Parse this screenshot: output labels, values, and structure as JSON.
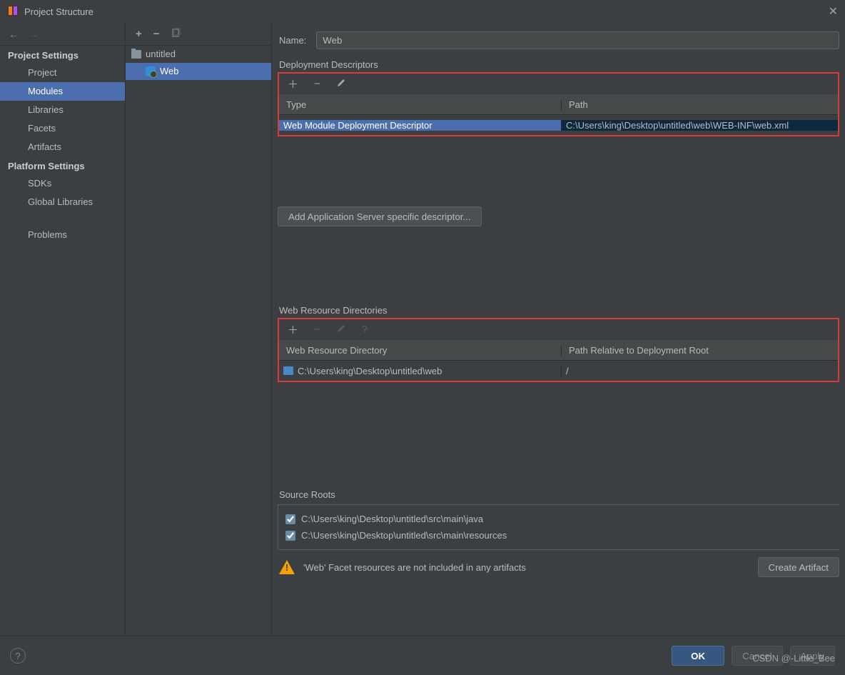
{
  "window": {
    "title": "Project Structure"
  },
  "sidebar": {
    "sections": [
      {
        "title": "Project Settings",
        "items": [
          {
            "label": "Project",
            "selected": false
          },
          {
            "label": "Modules",
            "selected": true
          },
          {
            "label": "Libraries",
            "selected": false
          },
          {
            "label": "Facets",
            "selected": false
          },
          {
            "label": "Artifacts",
            "selected": false
          }
        ]
      },
      {
        "title": "Platform Settings",
        "items": [
          {
            "label": "SDKs",
            "selected": false
          },
          {
            "label": "Global Libraries",
            "selected": false
          }
        ]
      },
      {
        "title": "",
        "items": [
          {
            "label": "Problems",
            "selected": false
          }
        ]
      }
    ]
  },
  "tree": {
    "root": {
      "label": "untitled"
    },
    "child": {
      "label": "Web",
      "selected": true
    }
  },
  "content": {
    "name_label": "Name:",
    "name_value": "Web",
    "deploy": {
      "label": "Deployment Descriptors",
      "cols": [
        "Type",
        "Path"
      ],
      "row": {
        "type": "Web Module Deployment Descriptor",
        "path": "C:\\Users\\king\\Desktop\\untitled\\web\\WEB-INF\\web.xml"
      },
      "add_button": "Add Application Server specific descriptor..."
    },
    "resdir": {
      "label": "Web Resource Directories",
      "cols": [
        "Web Resource Directory",
        "Path Relative to Deployment Root"
      ],
      "row": {
        "dir": "C:\\Users\\king\\Desktop\\untitled\\web",
        "rel": "/"
      }
    },
    "source": {
      "label": "Source Roots",
      "items": [
        "C:\\Users\\king\\Desktop\\untitled\\src\\main\\java",
        "C:\\Users\\king\\Desktop\\untitled\\src\\main\\resources"
      ]
    },
    "warning": {
      "text": "'Web' Facet resources are not included in any artifacts",
      "button": "Create Artifact"
    }
  },
  "buttons": {
    "ok": "OK",
    "cancel": "Cancel",
    "apply": "Apply"
  },
  "watermark": "CSDN @-Little_Bee"
}
